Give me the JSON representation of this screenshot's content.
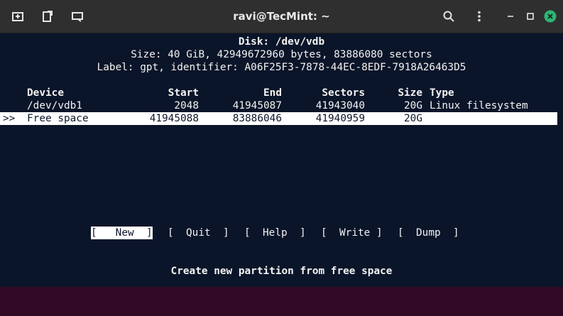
{
  "window": {
    "title": "ravi@TecMint: ~"
  },
  "titlebar": {
    "left_icons": [
      "new-tab-icon",
      "detach-icon",
      "screen-icon"
    ],
    "right_icons": [
      "search-icon",
      "kebab-menu-icon",
      "minimize-icon",
      "maximize-icon",
      "close-icon"
    ],
    "close_color": "#2bb673"
  },
  "disk": {
    "header": "Disk: /dev/vdb",
    "size_line": "Size: 40 GiB, 42949672960 bytes, 83886080 sectors",
    "label_line": "Label: gpt, identifier: A06F25F3-7878-44EC-8EDF-7918A26463D5"
  },
  "table": {
    "headers": {
      "device": "Device",
      "start": "Start",
      "end": "End",
      "sectors": "Sectors",
      "size": "Size",
      "type": "Type"
    },
    "rows": [
      {
        "marker": "",
        "device": "/dev/vdb1",
        "start": "2048",
        "end": "41945087",
        "sectors": "41943040",
        "size": "20G",
        "type": "Linux filesystem"
      },
      {
        "marker": ">>",
        "device": "Free space",
        "start": "41945088",
        "end": "83886046",
        "sectors": "41940959",
        "size": "20G",
        "type": ""
      }
    ]
  },
  "menu": {
    "items": [
      {
        "label": "[   New  ]",
        "selected": true
      },
      {
        "label": "[  Quit  ]",
        "selected": false
      },
      {
        "label": "[  Help  ]",
        "selected": false
      },
      {
        "label": "[  Write ]",
        "selected": false
      },
      {
        "label": "[  Dump  ]",
        "selected": false
      }
    ]
  },
  "status": "Create new partition from free space",
  "colors": {
    "terminal_bg": "#0b1529",
    "titlebar_bg": "#2f2f2f",
    "text": "#f2f2f2",
    "highlight_bg": "#ffffff"
  }
}
